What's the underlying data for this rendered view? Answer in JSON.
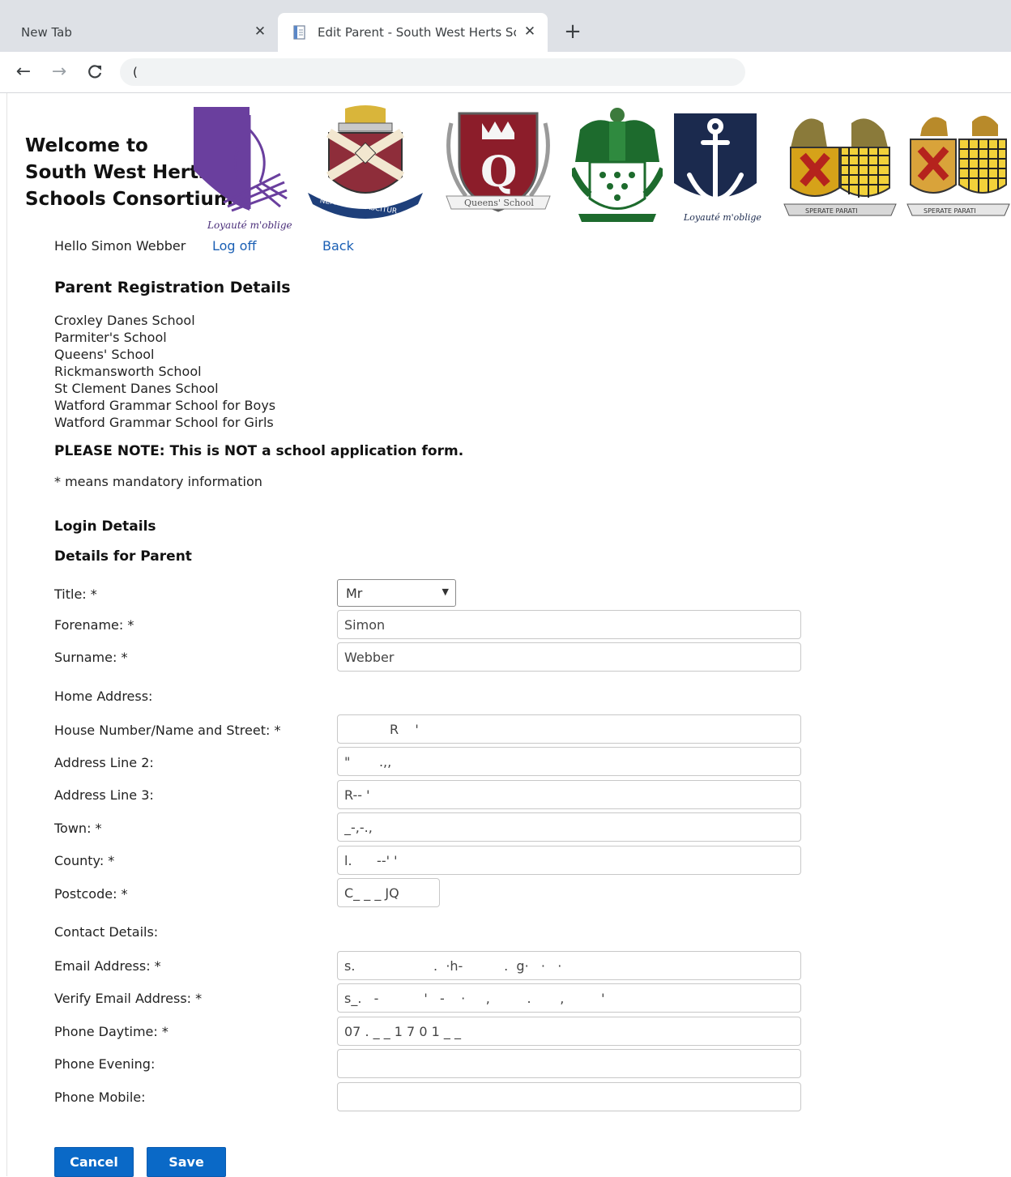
{
  "browser": {
    "tabs": [
      {
        "title": "New Tab",
        "active": false
      },
      {
        "title": "Edit Parent - South West Herts Sc",
        "active": true
      }
    ],
    "close_glyph": "✕",
    "new_tab_glyph": "+",
    "address_value": "(",
    "nav": {
      "back": "←",
      "forward": "→",
      "reload": "C"
    }
  },
  "header": {
    "welcome_lines": [
      "Welcome to",
      "South West Herts",
      "Schools Consortium"
    ],
    "crests": [
      {
        "name": "croxley-danes-crest-icon",
        "motto": "Loyauté m'oblige"
      },
      {
        "name": "parmiters-crest-icon",
        "motto": "NEMO SIBI NASCITUR"
      },
      {
        "name": "queens-school-crest-icon",
        "motto": "Queens' School"
      },
      {
        "name": "rickmansworth-crest-icon",
        "motto": ""
      },
      {
        "name": "anchor-crest-icon",
        "motto": "Loyauté m'oblige"
      },
      {
        "name": "watford-grammar-boys-crest-icon",
        "motto": "SPERATE PARATI"
      },
      {
        "name": "watford-grammar-girls-crest-icon",
        "motto": "SPERATE PARATI"
      }
    ]
  },
  "user_bar": {
    "greeting": "Hello Simon Webber",
    "logoff": "Log off",
    "back": "Back"
  },
  "page": {
    "title": "Parent Registration Details",
    "schools": [
      "Croxley Danes School",
      "Parmiter's School",
      "Queens' School",
      "Rickmansworth School",
      "St Clement Danes School",
      "Watford Grammar School for Boys",
      "Watford Grammar School for Girls"
    ],
    "note": "PLEASE NOTE: This is NOT a school application form.",
    "mandatory": "* means mandatory information",
    "login_details": "Login Details",
    "details_for_parent": "Details for Parent"
  },
  "form": {
    "title_label": "Title: *",
    "title_value": "Mr",
    "forename_label": "Forename: *",
    "forename_value": "Simon",
    "surname_label": "Surname: *",
    "surname_value": "Webber",
    "home_address_label": "Home Address:",
    "street_label": "House Number/Name and Street: *",
    "street_value": "           R    '",
    "address2_label": "Address Line 2:",
    "address2_value": "\"       .,,",
    "address3_label": "Address Line 3:",
    "address3_value": "R-- '",
    "town_label": "Town: *",
    "town_value": "_-,-.,",
    "county_label": "County: *",
    "county_value": "l.      --' '",
    "postcode_label": "Postcode: *",
    "postcode_value": "C_ _ _ JQ",
    "contact_label": "Contact Details:",
    "email_label": "Email Address: *",
    "email_value": "s.                   .  ·h-          .  g·   ·   ·",
    "verify_email_label": "Verify Email Address: *",
    "verify_email_value": "s_.   -           '   -    ·     ,         .       ,         '",
    "phone_day_label": "Phone Daytime: *",
    "phone_day_value": "07 . _ _ 1 7 0 1 _ _",
    "phone_eve_label": "Phone Evening:",
    "phone_eve_value": "",
    "phone_mob_label": "Phone Mobile:",
    "phone_mob_value": ""
  },
  "buttons": {
    "cancel": "Cancel",
    "save": "Save"
  }
}
